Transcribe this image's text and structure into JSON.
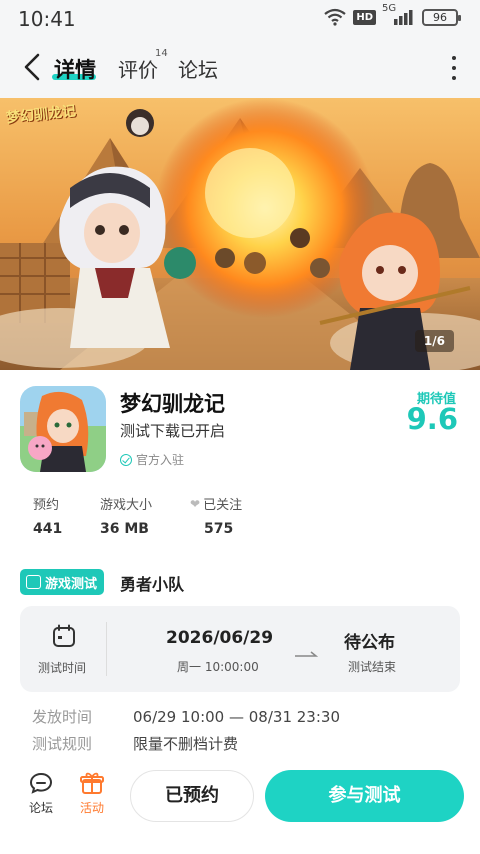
{
  "status_bar": {
    "time": "10:41",
    "hd": "HD",
    "network": "5G",
    "battery": "96"
  },
  "nav": {
    "tabs": [
      {
        "label": "详情",
        "active": true
      },
      {
        "label": "评价",
        "badge": "14"
      },
      {
        "label": "论坛"
      }
    ]
  },
  "banner": {
    "logo_text": "梦幻驯龙记",
    "page_indicator": "1/6"
  },
  "app": {
    "name": "梦幻驯龙记",
    "subtitle": "测试下载已开启",
    "official": "官方入驻",
    "expect_label": "期待值",
    "expect_value": "9.6"
  },
  "stats": [
    {
      "label": "预约",
      "value": "441"
    },
    {
      "label": "游戏大小",
      "value": "36 MB"
    },
    {
      "label": "已关注",
      "value": "575"
    }
  ],
  "test": {
    "badge": "游戏测试",
    "name": "勇者小队",
    "time_label": "测试时间",
    "date": "2026/06/29",
    "weekday_time": "周一  10:00:00",
    "end_status": "待公布",
    "end_label": "测试结束",
    "info": [
      {
        "key": "发放时间",
        "value": "06/29 10:00 — 08/31 23:30"
      },
      {
        "key": "测试规则",
        "value": "限量不删档计费"
      }
    ]
  },
  "bottom": {
    "forum": "论坛",
    "activity": "活动",
    "reserved": "已预约",
    "join": "参与测试"
  },
  "colors": {
    "accent": "#1ed3c4",
    "activity": "#ff7a2f"
  }
}
